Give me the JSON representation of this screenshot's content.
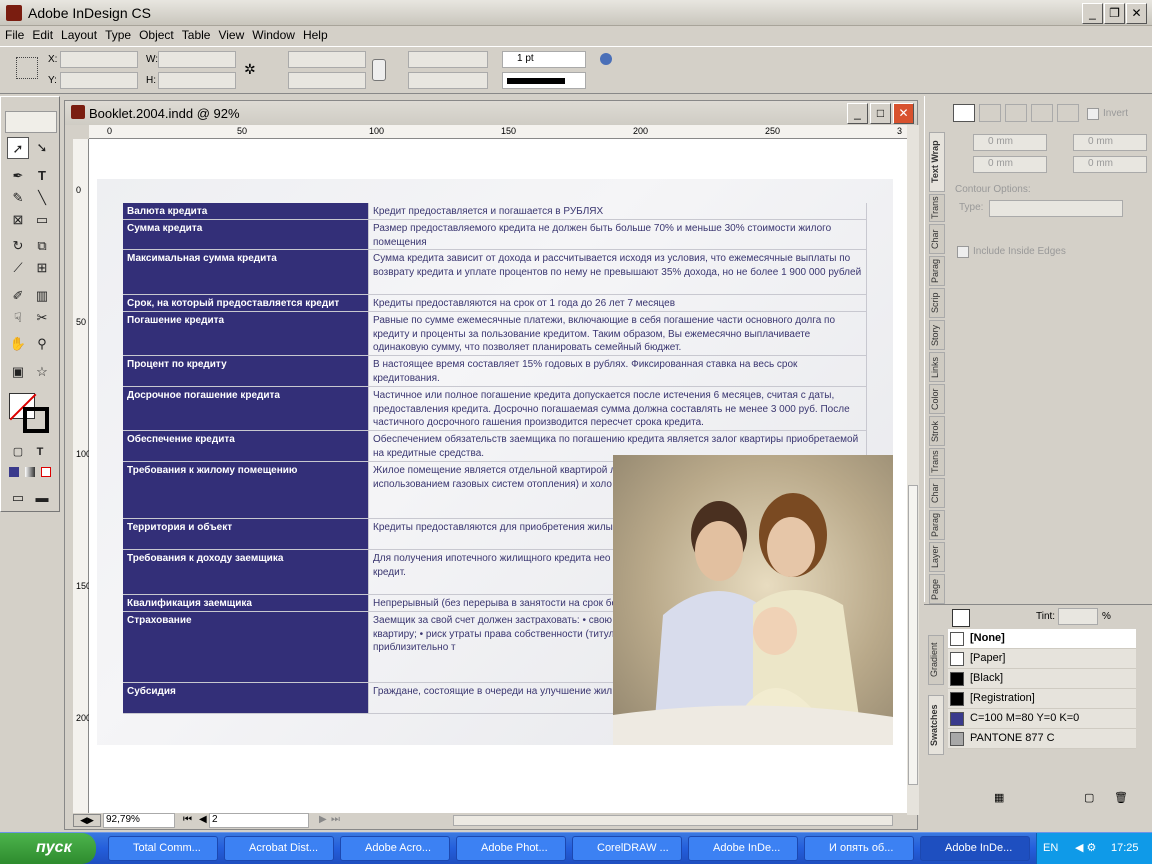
{
  "app": {
    "title": "Adobe InDesign CS"
  },
  "menu": [
    "File",
    "Edit",
    "Layout",
    "Type",
    "Object",
    "Table",
    "View",
    "Window",
    "Help"
  ],
  "control": {
    "x_label": "X:",
    "y_label": "Y:",
    "w_label": "W:",
    "h_label": "H:",
    "stroke_weight": "1 pt"
  },
  "doc": {
    "title": "Booklet.2004.indd @ 92%",
    "zoom": "92,79%",
    "page": "2",
    "ruler_h": [
      "0",
      "50",
      "100",
      "150",
      "200",
      "250",
      "3"
    ],
    "ruler_v": [
      "0",
      "50",
      "100",
      "150",
      "200"
    ]
  },
  "table": [
    {
      "label": "Валюта кредита",
      "text": "Кредит предоставляется и погашается в РУБЛЯХ"
    },
    {
      "label": "Сумма кредита",
      "text": "Размер предоставляемого кредита не должен быть больше 70% и меньше 30% стоимости жилого помещения"
    },
    {
      "label": "Максимальная сумма кредита",
      "text": "Сумма кредита зависит от дохода и рассчитывается исходя из условия, что ежемесячные выплаты по возврату кредита и уплате процентов по нему не превышают 35% дохода, но не более 1 900 000 рублей"
    },
    {
      "label": "Срок, на который предоставляется кредит",
      "text": "Кредиты предоставляются на срок от 1 года до 26 лет 7 месяцев"
    },
    {
      "label": "Погашение кредита",
      "text": "Равные по сумме ежемесячные платежи, включающие в себя погашение части основного долга по кредиту и проценты за пользование кредитом. Таким образом, Вы ежемесячно выплачиваете одинаковую сумму, что позволяет планировать семейный бюджет."
    },
    {
      "label": "Процент по кредиту",
      "text": "В настоящее время составляет 15% годовых в рублях. Фиксированная ставка на весь срок кредитования."
    },
    {
      "label": "Досрочное погашение кредита",
      "text": "Частичное или полное погашение кредита допускается после истечения 6 месяцев, считая с даты, предоставления кредита. Досрочно погашаемая сумма должна составлять не менее 3 000 руб. После частичного досрочного гашения производится пересчет срока кредита."
    },
    {
      "label": "Обеспечение кредита",
      "text": "Обеспечением обязательств заемщика по погашению кредита является залог квартиры приобретаемой на кредитные средства."
    },
    {
      "label": "Требования к жилому помещению",
      "text": "Жилое помещение является отдельной квартирой л электрическим, паровым или газовым системам от использованием газовых систем отопления) и холо сантехнического оборудования."
    },
    {
      "label": "Территория и объект",
      "text": "Кредиты предоставляются для приобретения жилы логды и Вологодской области."
    },
    {
      "label": "Требования к доходу заемщика",
      "text": "Для получения ипотечного жилищного кредита нео твержденный официальным документом , за 6 пос кредит."
    },
    {
      "label": "Квалификация заемщика",
      "text": "Непрерывный (без перерыва в занятости на срок бо"
    },
    {
      "label": "Страхование",
      "text": "Заемщик за свой счет должен застраховать: • свою жизнь и потерю трудоспособности; • приобретаемую квартиру; • риск утраты права собственности (титул) на приоб В сумме эти выплаты составляют приблизительно т"
    },
    {
      "label": "Субсидия",
      "text": "Граждане, состоящие в очереди на улучшение жил го кредита претендовать на получение целевой суб"
    }
  ],
  "textwrap": {
    "invert": "Invert",
    "offset": "0 mm",
    "contour_options": "Contour Options:",
    "type_label": "Type:",
    "include_inside": "Include Inside Edges"
  },
  "panel_tabs": [
    "Text Wrap",
    "Trans",
    "Char",
    "Parag",
    "Scrip",
    "Story",
    "Links",
    "Color",
    "Strok",
    "Trans",
    "Char",
    "Parag",
    "Layer",
    "Page"
  ],
  "swatch_tabs": [
    "Gradient",
    "Swatches"
  ],
  "tint_label": "Tint:",
  "tint_unit": "%",
  "swatches": [
    {
      "name": "[None]",
      "color": "#ffffff"
    },
    {
      "name": "[Paper]",
      "color": "#ffffff"
    },
    {
      "name": "[Black]",
      "color": "#000000"
    },
    {
      "name": "[Registration]",
      "color": "#000000"
    },
    {
      "name": "C=100 M=80 Y=0 K=0",
      "color": "#3a3a8c"
    },
    {
      "name": "PANTONE 877 C",
      "color": "#a8a8a8"
    }
  ],
  "taskbar": {
    "start": "пуск",
    "tasks": [
      "Total Comm...",
      "Acrobat Dist...",
      "Adobe Acro...",
      "Adobe Phot...",
      "CorelDRAW ...",
      "Adobe InDe...",
      "И опять об...",
      "Adobe InDe..."
    ],
    "lang": "EN",
    "time": "17:25"
  }
}
